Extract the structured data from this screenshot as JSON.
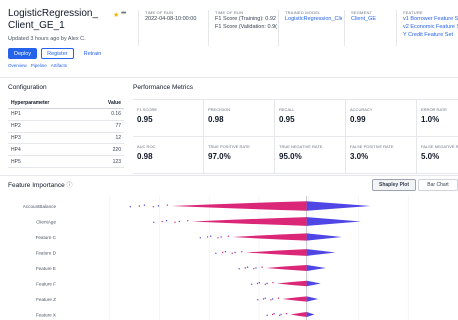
{
  "model": {
    "title": "LogisticRegression_ Client_GE_1",
    "star_icon": "star-icon",
    "more_icon": "more-icon",
    "updated": "Updated 3 hours ago by Alex C.",
    "deploy": "Deploy",
    "register": "Register",
    "retrain": "Retrain"
  },
  "tabs": [
    "Overview",
    "Pipeline",
    "Artifacts"
  ],
  "meta": {
    "time_of_run": {
      "label": "TIME OF RUN",
      "value": "2022-04-08-10:00:00"
    },
    "time_of_run_2": {
      "label": "TIME OF RUN",
      "line1": "F1 Score (Training): 0.92",
      "line2": "F1 Score (Validation: 0.9("
    },
    "trained_model": {
      "label": "TRAINED MODEL",
      "value": "LogisticRegression_Clien"
    },
    "segment": {
      "label": "SEGMENT",
      "value": "Client_GE"
    },
    "feature": {
      "label": "FEATURE",
      "line1": "v1 Borrower Feature Se",
      "line2": "v2 Economic Feature S",
      "line3": "Y Credit Feature Set"
    }
  },
  "configuration": {
    "title": "Configuration",
    "headers": [
      "Hyperparameter",
      "Value"
    ],
    "rows": [
      [
        "HP1",
        "0.16"
      ],
      [
        "HP2",
        "77"
      ],
      [
        "HP3",
        "12"
      ],
      [
        "HP4",
        "220"
      ],
      [
        "HP5",
        "123"
      ]
    ]
  },
  "performance": {
    "title": "Performance Metrics",
    "metrics": [
      {
        "label": "F1 SCORE",
        "value": "0.95"
      },
      {
        "label": "PRECISION",
        "value": "0.98"
      },
      {
        "label": "RECALL",
        "value": "0.95"
      },
      {
        "label": "ACCURACY",
        "value": "0.99"
      },
      {
        "label": "ERROR RATE",
        "value": "1.0%"
      },
      {
        "label": "AUC ROC",
        "value": "0.98"
      },
      {
        "label": "TRUE POSITIVE RATE",
        "value": "97.0%"
      },
      {
        "label": "TRUE NEGATIVE RATE",
        "value": "95.0%"
      },
      {
        "label": "FALSE POSITIVE RATE",
        "value": "3.0%"
      },
      {
        "label": "FALSE NEGATIVE RATE",
        "value": "5.0%"
      }
    ]
  },
  "feature_importance": {
    "title": "Feature Importance",
    "info_icon": "info-icon",
    "shapley_label": "Shapley Plot",
    "bar_label": "Bar Chart",
    "colors": {
      "low": "#4f46e5",
      "high": "#db2777"
    },
    "features": [
      {
        "name": "AccountBalance",
        "spread": 1.0
      },
      {
        "name": "ClientAge",
        "spread": 0.85
      },
      {
        "name": "Feature C",
        "spread": 0.55
      },
      {
        "name": "Feature D",
        "spread": 0.45
      },
      {
        "name": "Feature E",
        "spread": 0.3
      },
      {
        "name": "Feature F",
        "spread": 0.22
      },
      {
        "name": "Feature Z",
        "spread": 0.18
      },
      {
        "name": "Feature X",
        "spread": 0.12
      }
    ]
  }
}
